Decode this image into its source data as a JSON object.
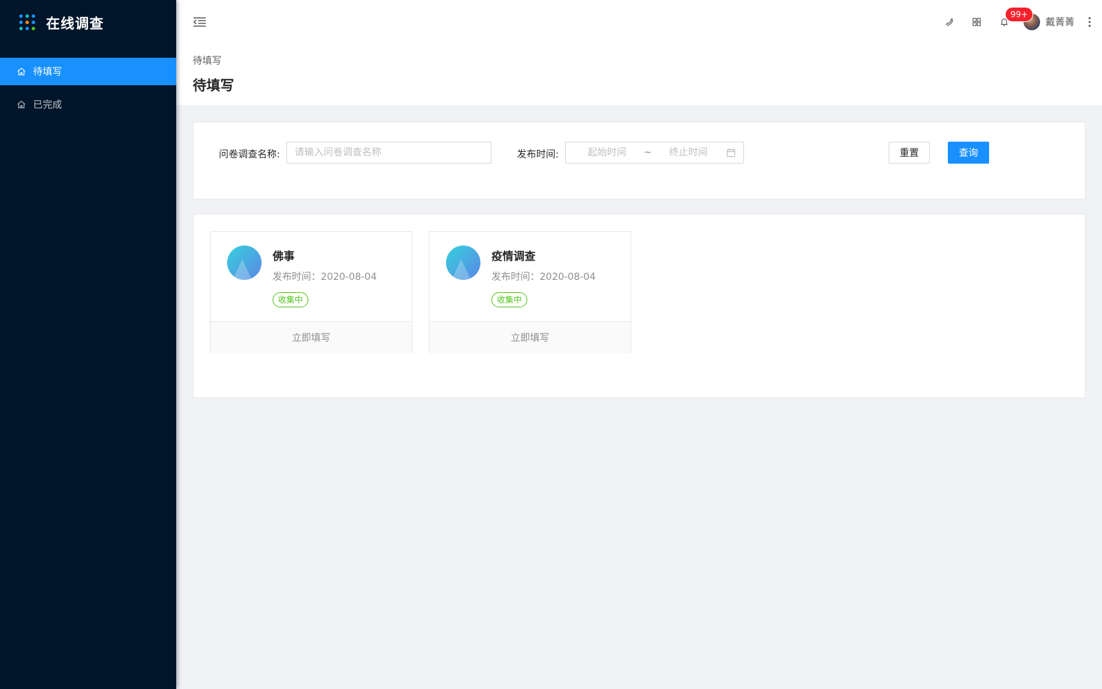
{
  "app": {
    "title": "在线调查"
  },
  "sidebar": {
    "items": [
      {
        "label": "待填写",
        "active": true,
        "icon": "home-icon"
      },
      {
        "label": "已完成",
        "active": false,
        "icon": "home-icon"
      }
    ]
  },
  "header": {
    "notification_count": "99+",
    "user_name": "戴菁菁",
    "icons": [
      "menu-fold-icon",
      "phone-icon",
      "appstore-icon",
      "bell-icon",
      "more-vertical-icon"
    ]
  },
  "page": {
    "breadcrumb": "待填写",
    "title": "待填写"
  },
  "search": {
    "name_label": "问卷调查名称:",
    "name_placeholder": "请输入问卷调查名称",
    "time_label": "发布时间:",
    "start_placeholder": "起始时间",
    "range_separator": "~",
    "end_placeholder": "终止时间",
    "reset_label": "重置",
    "query_label": "查询"
  },
  "surveys": [
    {
      "title": "佛事",
      "time": "发布时间：2020-08-04",
      "status": "收集中",
      "action": "立即填写"
    },
    {
      "title": "疫情调查",
      "time": "发布时间：2020-08-04",
      "status": "收集中",
      "action": "立即填写"
    }
  ],
  "colors": {
    "sidebar_bg": "#001529",
    "primary": "#1890ff",
    "status_green": "#52c41a",
    "badge_red": "#f5222d"
  }
}
